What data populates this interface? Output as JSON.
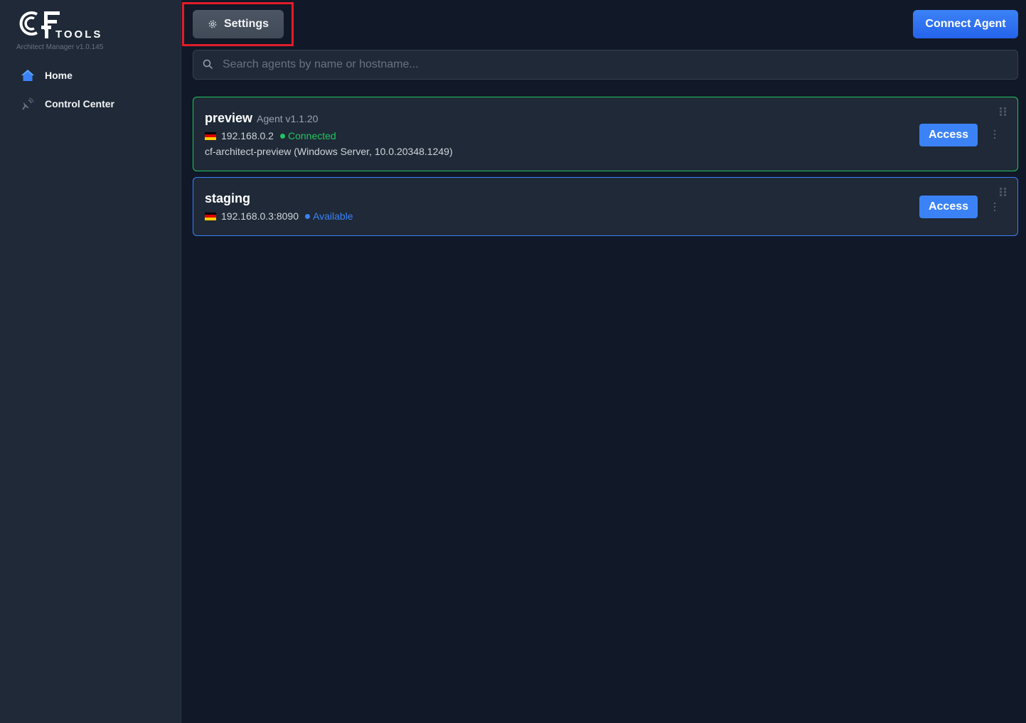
{
  "app": {
    "logo_letters": "CF",
    "logo_word": "TOOLS",
    "version": "Architect Manager v1.0.145"
  },
  "sidebar": {
    "items": [
      {
        "label": "Home",
        "icon": "home-icon"
      },
      {
        "label": "Control Center",
        "icon": "satellite-dish-icon"
      }
    ]
  },
  "header": {
    "settings_label": "Settings",
    "settings_icon": "gear-icon",
    "connect_label": "Connect Agent"
  },
  "search": {
    "placeholder": "Search agents by name or hostname...",
    "value": ""
  },
  "agents": [
    {
      "name": "preview",
      "version": "Agent v1.1.20",
      "ip": "192.168.0.2",
      "status": "Connected",
      "status_color": "#22c55e",
      "host": "cf-architect-preview (Windows Server, 10.0.20348.1249)",
      "access_label": "Access",
      "country_flag": "germany-flag-icon"
    },
    {
      "name": "staging",
      "ip": "192.168.0.3:8090",
      "status": "Available",
      "status_color": "#3b82f6",
      "access_label": "Access",
      "country_flag": "germany-flag-icon"
    }
  ],
  "colors": {
    "background": "#111827",
    "sidebar": "#1f2937",
    "accent": "#3b82f6",
    "connected": "#22c55e",
    "highlight": "#e11d2a"
  }
}
